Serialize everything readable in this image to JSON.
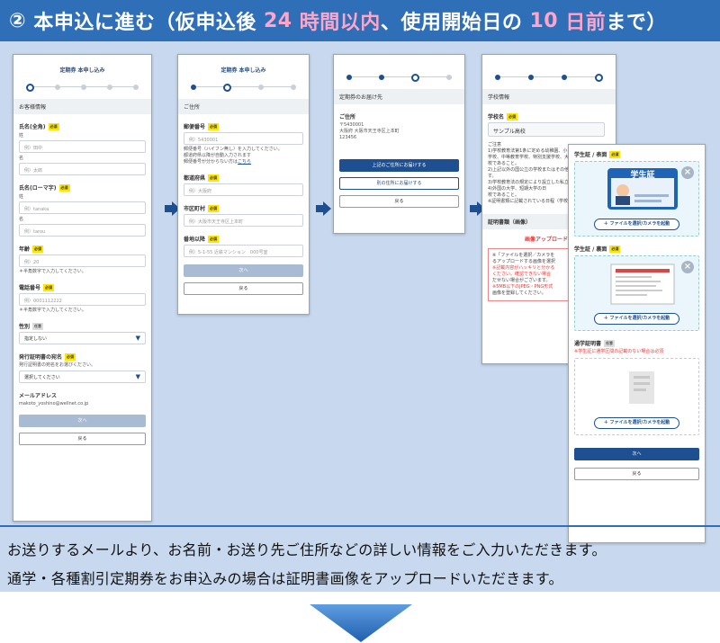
{
  "header": {
    "num": "②",
    "pre": "本申込に進む（仮申込後",
    "hours": "24",
    "mid": "時間以内",
    "post": "、使用開始日の",
    "days": "10",
    "end1": "日前",
    "end2": "まで）"
  },
  "colors": {
    "banner": "#2f6fb8",
    "highlight": "#ffa5c8",
    "primary": "#1d4f91"
  },
  "screen1": {
    "title": "定期券 本申し込み",
    "section": "お客様情報",
    "name_label": "氏名(全角)",
    "required": "必須",
    "optional": "任意",
    "sei": "姓",
    "sei_ph": "例）田中",
    "mei": "名",
    "mei_ph": "例）太郎",
    "roman_label": "氏名(ローマ字)",
    "roman_sei_ph": "例）tanaka",
    "roman_mei_ph": "例）tarou",
    "age_label": "年齢",
    "age_ph": "例）20",
    "halfwidth_note": "＊半角数字で入力してください。",
    "phone_label": "電話番号",
    "phone_ph": "例）0001112222",
    "gender_label": "性別",
    "gender_value": "指定しない",
    "proof_label": "発行証明書の宛名",
    "proof_note": "発行証明書の宛名をお選びください。",
    "proof_value": "選択してください",
    "mail_label": "メールアドレス",
    "mail_value": "makoto_yoshino@wellnet.co.jp",
    "next": "次へ",
    "back": "戻る"
  },
  "screen2": {
    "title": "定期券 本申し込み",
    "section": "ご住所",
    "zip_label": "郵便番号",
    "zip_ph": "例）5430001",
    "zip_note1": "郵便番号（ハイフン無し）を入力してください。",
    "zip_note2": "都道府県以降が自動入力されます",
    "zip_note3": "郵便番号が分からない方は",
    "zip_link": "こちら",
    "pref_label": "都道府県",
    "pref_ph": "例）大阪府",
    "city_label": "市区町村",
    "city_ph": "例）大阪市天王寺区上本町",
    "street_label": "番地以降",
    "street_ph": "例）5-1-55 近鉄マンション　000号室",
    "next": "次へ",
    "back": "戻る"
  },
  "screen3": {
    "section": "定期券のお届け先",
    "addr_label": "ご住所",
    "addr_zip": "〒5430001",
    "addr_line": "大阪府 大阪市天王寺区上本町",
    "addr_num": "123456",
    "primary_btn": "上記のご住所にお届けする",
    "other_btn": "別の住所にお届けする",
    "back": "戻る"
  },
  "screen4": {
    "section": "学校情報",
    "school_label": "学校名",
    "school_value": "サンプル高校",
    "notes": [
      "ご注意",
      "1)学校教育法第1条に定める幼稚園、小",
      "学校、中等教育学校、特別支援学校、大",
      "校であること。",
      "2)上記以外の国公立の学校またはその他",
      "す。",
      "3)学校教育法の規定により設立した私立",
      "4)外国の大学、短期大学の日",
      "校であること。",
      "※証明書類に記載されている日程（学校"
    ],
    "doc_label": "証明書類（画像）",
    "upload_title": "画像アップロード時",
    "warn1": "※「ファイルを選択／カメラを",
    "warn2": "るアップロードする画像を選択",
    "warn3": "※記載内容がハッキリと分かる",
    "warn4": "ください。確認できない場合",
    "warn5": "だせない場合がございます。",
    "warn6": "※5MB以下のJPEG・PNG形式",
    "warn7": "画像を登録してください。"
  },
  "screen5": {
    "front_label": "学生証 / 表面",
    "back_label": "学生証 / 裏面",
    "certificate_label": "通学証明書",
    "cert_note": "※学生証に通学区間の記載のない場合は必須",
    "card_text": "学生証",
    "upload_btn": "＋ ファイルを選択/カメラを起動",
    "next": "次へ",
    "back": "戻る"
  },
  "caption": {
    "line1": "お送りするメールより、お名前・お送り先ご住所などの詳しい情報をご入力いただきます。",
    "line2": "通学・各種割引定期券をお申込みの場合は証明書画像をアップロードいただきます。"
  }
}
